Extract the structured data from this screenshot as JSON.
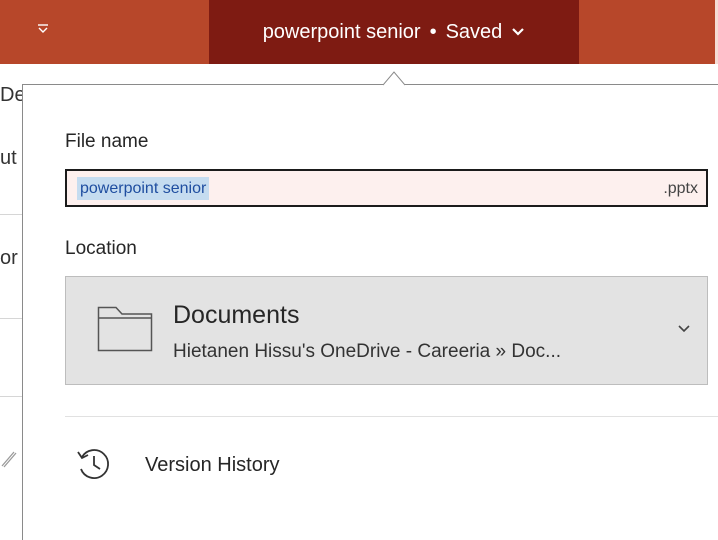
{
  "titlebar": {
    "document_name": "powerpoint senior",
    "separator": "•",
    "save_status": "Saved"
  },
  "background_fragments": {
    "row1": "De",
    "row2": "ut",
    "row3": "or"
  },
  "flyout": {
    "file_name_label": "File name",
    "file_name_value": "powerpoint senior",
    "file_extension": ".pptx",
    "location_label": "Location",
    "location": {
      "title": "Documents",
      "path": "Hietanen Hissu's OneDrive - Careeria » Doc..."
    },
    "version_history_label": "Version History"
  },
  "icons": {
    "qat": "chevron-down-bar-icon",
    "title_dropdown": "chevron-down-icon",
    "folder": "folder-icon",
    "location_dropdown": "chevron-down-icon",
    "version_history": "history-clock-icon"
  },
  "colors": {
    "titlebar": "#b7472a",
    "title_pill": "#7e1b12",
    "selection": "#c5dcf0",
    "location_bg": "#e3e3e3"
  }
}
